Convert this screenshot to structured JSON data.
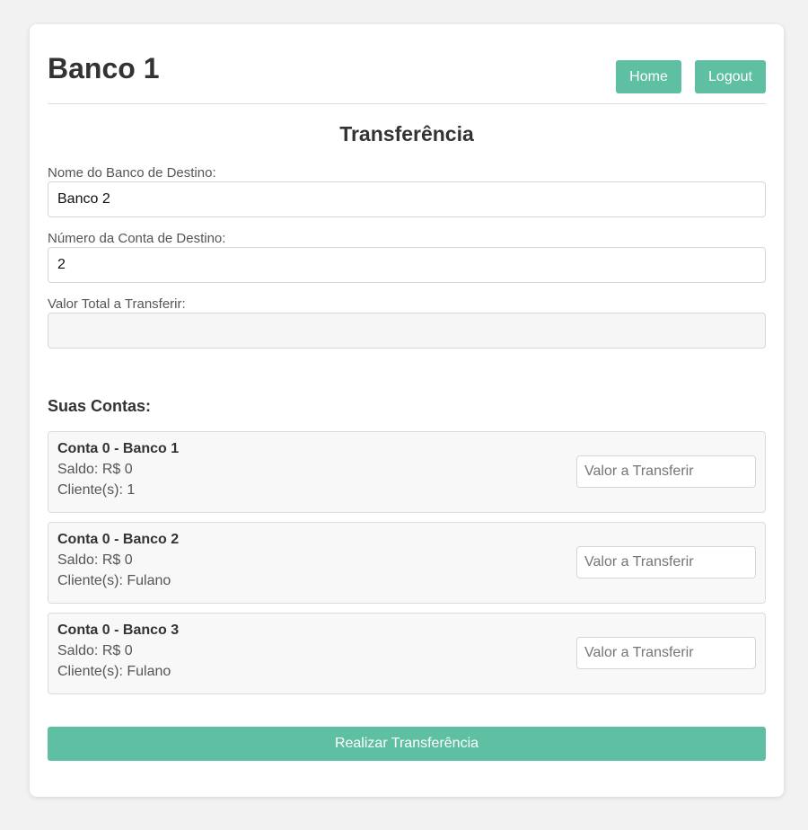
{
  "header": {
    "brand": "Banco 1",
    "home_label": "Home",
    "logout_label": "Logout"
  },
  "form": {
    "title": "Transferência",
    "dest_bank": {
      "label": "Nome do Banco de Destino:",
      "value": "Banco 2"
    },
    "dest_account": {
      "label": "Número da Conta de Destino:",
      "value": "2"
    },
    "total": {
      "label": "Valor Total a Transferir:",
      "value": ""
    }
  },
  "accounts": {
    "title": "Suas Contas:",
    "items": [
      {
        "name": "Conta 0 - Banco 1",
        "saldo": "Saldo: R$ 0",
        "clients": "Cliente(s): 1",
        "placeholder": "Valor a Transferir"
      },
      {
        "name": "Conta 0 - Banco 2",
        "saldo": "Saldo: R$ 0",
        "clients": "Cliente(s): Fulano",
        "placeholder": "Valor a Transferir"
      },
      {
        "name": "Conta 0 - Banco 3",
        "saldo": "Saldo: R$ 0",
        "clients": "Cliente(s): Fulano",
        "placeholder": "Valor a Transferir"
      }
    ]
  },
  "submit_label": "Realizar Transferência",
  "colors": {
    "accent": "#5fbfa3",
    "background": "#f2f2f2",
    "card": "#ffffff"
  }
}
